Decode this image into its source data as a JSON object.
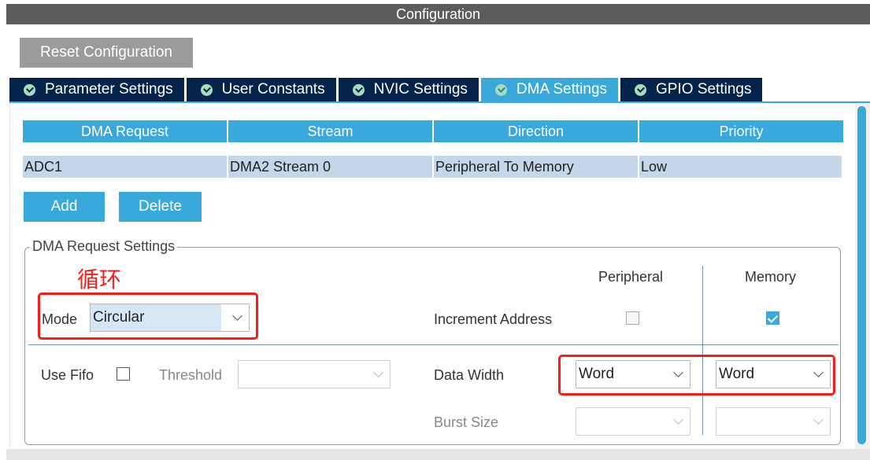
{
  "window": {
    "title": "Configuration"
  },
  "toolbar": {
    "reset_label": "Reset Configuration"
  },
  "tabs": [
    {
      "label": "Parameter Settings",
      "active": false
    },
    {
      "label": "User Constants",
      "active": false
    },
    {
      "label": "NVIC Settings",
      "active": false
    },
    {
      "label": "DMA Settings",
      "active": true
    },
    {
      "label": "GPIO Settings",
      "active": false
    }
  ],
  "dma_table": {
    "headers": [
      "DMA Request",
      "Stream",
      "Direction",
      "Priority"
    ],
    "rows": [
      [
        "ADC1",
        "DMA2 Stream 0",
        "Peripheral To Memory",
        "Low"
      ]
    ]
  },
  "actions": {
    "add_label": "Add",
    "delete_label": "Delete"
  },
  "request_settings": {
    "legend": "DMA Request Settings",
    "annotation": "循环",
    "mode_label": "Mode",
    "mode_value": "Circular",
    "peripheral_header": "Peripheral",
    "memory_header": "Memory",
    "increment_label": "Increment Address",
    "increment_peripheral": false,
    "increment_memory": true,
    "use_fifo_label": "Use Fifo",
    "use_fifo": false,
    "threshold_label": "Threshold",
    "threshold_value": "",
    "data_width_label": "Data Width",
    "data_width_peripheral": "Word",
    "data_width_memory": "Word",
    "burst_size_label": "Burst Size",
    "burst_peripheral": "",
    "burst_memory": ""
  },
  "colors": {
    "accent": "#39a8db",
    "tab_dark": "#03234b",
    "highlight_red": "#ff1a1a",
    "row_bg": "#c4d6ea"
  }
}
